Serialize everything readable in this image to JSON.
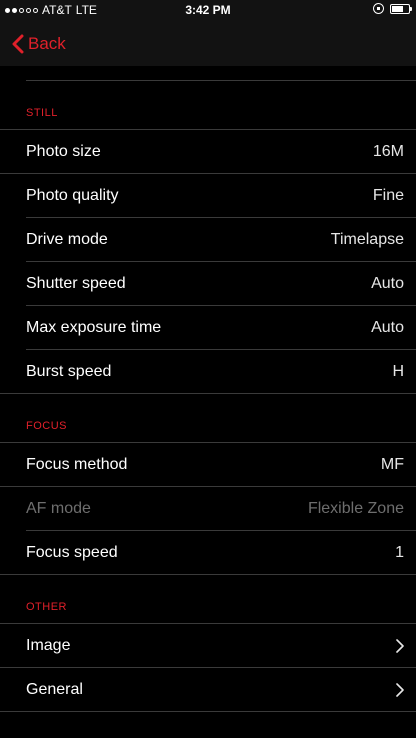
{
  "status_bar": {
    "carrier": "AT&T",
    "network": "LTE",
    "time": "3:42 PM",
    "signal_bars_filled": 2,
    "signal_bars_total": 5,
    "icons": [
      "lock-rotation-icon",
      "battery-icon"
    ]
  },
  "nav": {
    "back_label": "Back",
    "accent_color": "#e0202a"
  },
  "sections": {
    "still": {
      "header": "STILL",
      "rows": [
        {
          "label": "Photo size",
          "value": "16M"
        },
        {
          "label": "Photo quality",
          "value": "Fine"
        },
        {
          "label": "Drive mode",
          "value": "Timelapse"
        },
        {
          "label": "Shutter speed",
          "value": "Auto"
        },
        {
          "label": "Max exposure time",
          "value": "Auto"
        },
        {
          "label": "Burst speed",
          "value": "H"
        }
      ]
    },
    "focus": {
      "header": "FOCUS",
      "rows": [
        {
          "label": "Focus method",
          "value": "MF"
        },
        {
          "label": "AF mode",
          "value": "Flexible Zone",
          "disabled": true
        },
        {
          "label": "Focus speed",
          "value": "1"
        }
      ]
    },
    "other": {
      "header": "OTHER",
      "rows": [
        {
          "label": "Image",
          "icon": "chevron-right-icon"
        },
        {
          "label": "General",
          "icon": "chevron-right-icon"
        }
      ]
    }
  }
}
